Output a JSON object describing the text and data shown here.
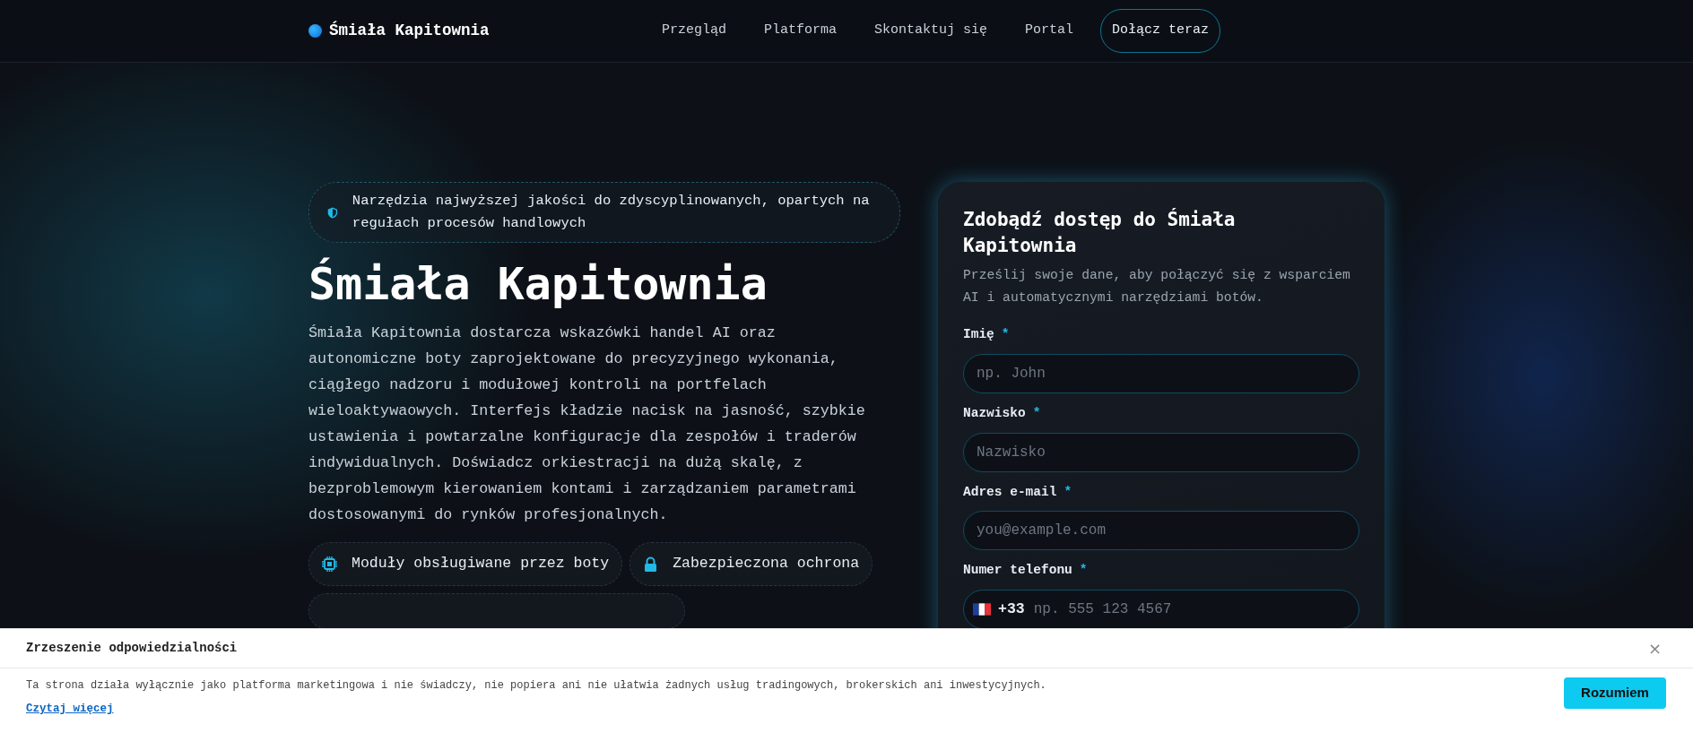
{
  "brand": {
    "name": "Śmiała Kapitownia"
  },
  "nav": {
    "links": [
      {
        "label": "Przegląd"
      },
      {
        "label": "Platforma"
      },
      {
        "label": "Skontaktuj się"
      },
      {
        "label": "Portal"
      }
    ],
    "cta": "Dołącz teraz"
  },
  "hero": {
    "badge": "Narzędzia najwyższej jakości do zdyscyplinowanych, opartych na regułach procesów handlowych",
    "title": "Śmiała Kapitownia",
    "description": "Śmiała Kapitownia dostarcza wskazówki handel AI oraz autonomiczne boty zaprojektowane do precyzyjnego wykonania, ciągłego nadzoru i modułowej kontroli na portfelach wieloaktywaowych. Interfejs kładzie nacisk na jasność, szybkie ustawienia i powtarzalne konfiguracje dla zespołów i traderów indywidualnych. Doświadcz orkiestracji na dużą skalę, z bezproblemowym kierowaniem kontami i zarządzaniem parametrami dostosowanymi do rynków profesjonalnych.",
    "chips": [
      {
        "label": "Moduły obsługiwane przez boty"
      },
      {
        "label": "Zabezpieczona ochrona"
      }
    ]
  },
  "form": {
    "title": "Zdobądź dostęp do Śmiała Kapitownia",
    "subtitle": "Prześlij swoje dane, aby połączyć się z wsparciem AI i automatycznymi narzędziami botów.",
    "fields": [
      {
        "kind": "text",
        "label": "Imię",
        "required_mark": "*",
        "placeholder": "np. John"
      },
      {
        "kind": "text",
        "label": "Nazwisko",
        "required_mark": "*",
        "placeholder": "Nazwisko"
      },
      {
        "kind": "email",
        "label": "Adres e-mail",
        "required_mark": "*",
        "placeholder": "you@example.com"
      },
      {
        "kind": "phone",
        "label": "Numer telefonu",
        "required_mark": "*",
        "dial_code": "+33",
        "placeholder": "np. 555 123 4567"
      }
    ]
  },
  "banner": {
    "title": "Zrzeszenie odpowiedzialności",
    "close": "×",
    "text": "Ta strona działa wyłącznie jako platforma marketingowa i nie świadczy, nie popiera ani nie ułatwia żadnych usług tradingowych, brokerskich ani inwestycyjnych.",
    "link": "Czytaj więcej",
    "button": "Rozumiem"
  }
}
